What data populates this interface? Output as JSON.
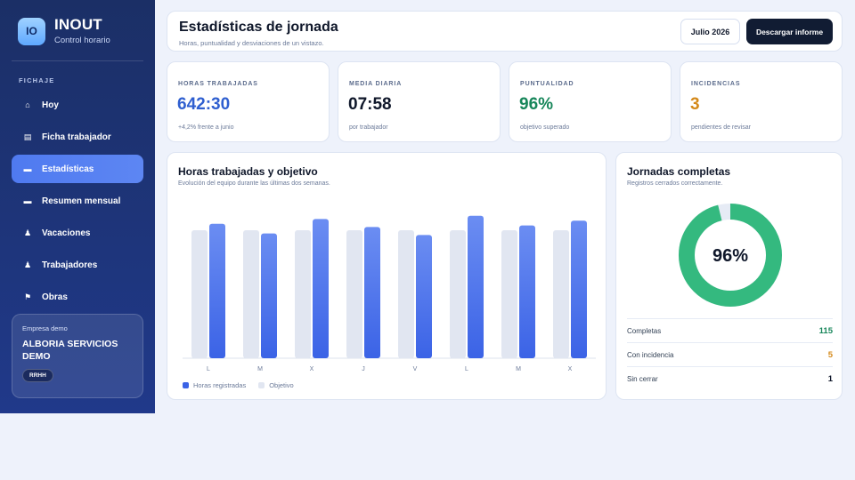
{
  "app": {
    "logo": "IO",
    "name": "INOUT",
    "subtitle": "Control horario"
  },
  "sidebar": {
    "section": "FICHAJE",
    "items": [
      {
        "label": "Hoy",
        "icon": "home-icon",
        "glyph": "⌂",
        "active": false
      },
      {
        "label": "Ficha trabajador",
        "icon": "id-card-icon",
        "glyph": "▤",
        "active": false
      },
      {
        "label": "Estadísticas",
        "icon": "stats-icon",
        "glyph": "▬",
        "active": true
      },
      {
        "label": "Resumen mensual",
        "icon": "calendar-icon",
        "glyph": "▬",
        "active": false
      },
      {
        "label": "Vacaciones",
        "icon": "person-icon",
        "glyph": "♟",
        "active": false
      },
      {
        "label": "Trabajadores",
        "icon": "people-icon",
        "glyph": "♟",
        "active": false
      },
      {
        "label": "Obras",
        "icon": "flag-icon",
        "glyph": "⚑",
        "active": false
      }
    ],
    "company": {
      "label": "Empresa demo",
      "name": "ALBORIA SERVICIOS DEMO",
      "badge": "RRHH"
    }
  },
  "header": {
    "title": "Estadísticas de jornada",
    "subtitle": "Horas, puntualidad y desviaciones de un vistazo.",
    "month_button": "Julio 2026",
    "download_button": "Descargar informe"
  },
  "kpis": [
    {
      "label": "HORAS TRABAJADAS",
      "value": "642:30",
      "note": "+4,2% frente a junio",
      "color": "#2f5fd0"
    },
    {
      "label": "MEDIA DIARIA",
      "value": "07:58",
      "note": "por trabajador",
      "color": "#0f172a"
    },
    {
      "label": "PUNTUALIDAD",
      "value": "96%",
      "note": "objetivo superado",
      "color": "#17865a"
    },
    {
      "label": "INCIDENCIAS",
      "value": "3",
      "note": "pendientes de revisar",
      "color": "#d4891a"
    }
  ],
  "chart_card": {
    "title": "Horas trabajadas y objetivo",
    "subtitle": "Evolución del equipo durante las últimas dos semanas."
  },
  "chart_data": {
    "type": "bar",
    "title": "Horas trabajadas y objetivo",
    "categories": [
      "L",
      "M",
      "X",
      "J",
      "V",
      "L",
      "M",
      "X"
    ],
    "series": [
      {
        "name": "Objetivo",
        "values": [
          8.0,
          8.0,
          8.0,
          8.0,
          8.0,
          8.0,
          8.0,
          8.0
        ],
        "color": "#e1e6f1"
      },
      {
        "name": "Horas registradas",
        "values": [
          8.4,
          7.8,
          8.7,
          8.2,
          7.7,
          8.9,
          8.3,
          8.6
        ],
        "color": "#3b63e6"
      }
    ],
    "ylim": [
      0,
      10
    ],
    "grid": false,
    "legend": "bottom-left"
  },
  "donut_card": {
    "title": "Jornadas completas",
    "subtitle": "Registros cerrados correctamente.",
    "center": "96%",
    "percent": 96,
    "color_fill": "#34b97f",
    "color_track": "#e6ebf5",
    "rows": [
      {
        "label": "Completas",
        "value": "115",
        "color": "#17865a"
      },
      {
        "label": "Con incidencia",
        "value": "5",
        "color": "#d4891a"
      },
      {
        "label": "Sin cerrar",
        "value": "1",
        "color": "#0f172a"
      }
    ]
  }
}
